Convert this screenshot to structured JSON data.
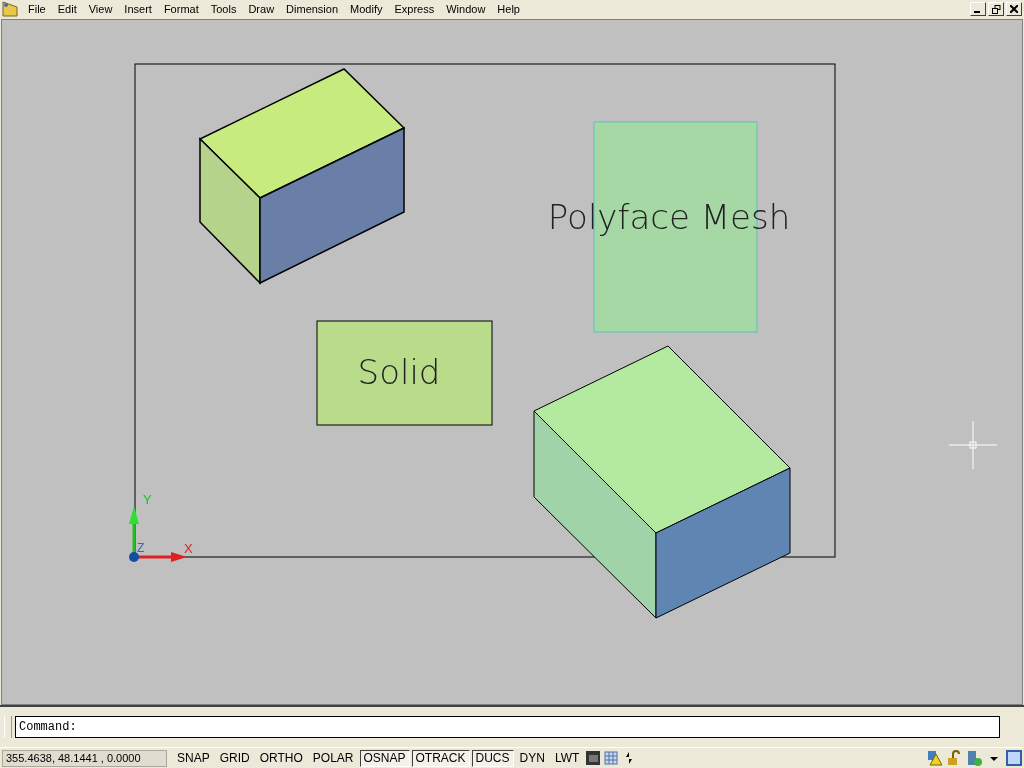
{
  "menu": [
    "File",
    "Edit",
    "View",
    "Insert",
    "Format",
    "Tools",
    "Draw",
    "Dimension",
    "Modify",
    "Express",
    "Window",
    "Help"
  ],
  "drawing": {
    "mesh_label": "Polyface Mesh",
    "solid_label": "Solid",
    "axis_x": "X",
    "axis_y": "Y",
    "axis_z": "Z"
  },
  "command_line": {
    "prompt": "Command:"
  },
  "status_bar": {
    "coordinates": "355.4638, 48.1441 , 0.0000",
    "toggles": [
      {
        "label": "SNAP",
        "on": false
      },
      {
        "label": "GRID",
        "on": false
      },
      {
        "label": "ORTHO",
        "on": false
      },
      {
        "label": "POLAR",
        "on": false
      },
      {
        "label": "OSNAP",
        "on": true
      },
      {
        "label": "OTRACK",
        "on": true
      },
      {
        "label": "DUCS",
        "on": true
      },
      {
        "label": "DYN",
        "on": false
      },
      {
        "label": "LWT",
        "on": false
      }
    ]
  }
}
